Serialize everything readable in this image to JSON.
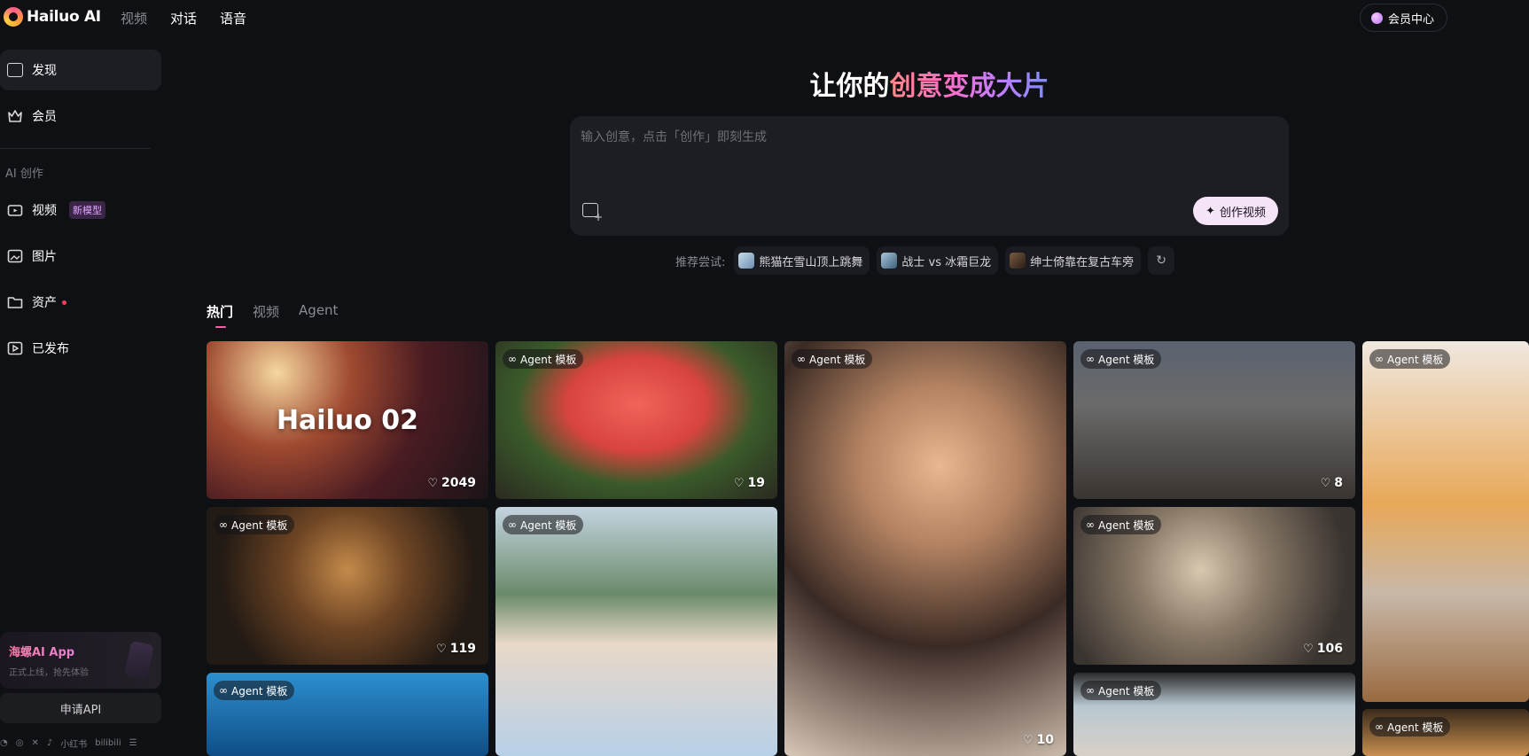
{
  "header": {
    "logo_text": "Hailuo AI",
    "nav": [
      {
        "label": "视频",
        "state": "muted"
      },
      {
        "label": "对话",
        "state": "normal"
      },
      {
        "label": "语音",
        "state": "normal"
      }
    ],
    "vip_button": "会员中心"
  },
  "sidebar": {
    "items": [
      {
        "label": "发现",
        "icon": "discover-icon",
        "active": true
      },
      {
        "label": "会员",
        "icon": "crown-icon",
        "active": false
      }
    ],
    "section_title": "AI 创作",
    "create_items": [
      {
        "label": "视频",
        "icon": "video-icon",
        "badge": "新模型"
      },
      {
        "label": "图片",
        "icon": "image-icon"
      },
      {
        "label": "资产",
        "icon": "folder-icon",
        "dot": true
      },
      {
        "label": "已发布",
        "icon": "published-icon"
      }
    ],
    "app_promo": {
      "title": "海螺AI App",
      "subtitle": "正式上线，抢先体验"
    },
    "api_button": "申请API",
    "social": [
      "wechat-icon",
      "weibo-icon",
      "x-icon",
      "tiktok-icon",
      "小红书",
      "bilibili",
      "more-icon"
    ]
  },
  "hero": {
    "title_plain": "让你的",
    "title_gradient": "创意变成大片",
    "placeholder": "输入创意，点击「创作」即刻生成",
    "create_button": "创作视频"
  },
  "suggestions": {
    "label": "推荐尝试:",
    "chips": [
      {
        "label": "熊猫在雪山顶上跳舞",
        "color": "#7fa6c8"
      },
      {
        "label": "战士 vs 冰霜巨龙",
        "color": "#5e89a8"
      },
      {
        "label": "绅士倚靠在复古车旁",
        "color": "#5b4636"
      }
    ]
  },
  "tabs": [
    {
      "label": "热门",
      "active": true
    },
    {
      "label": "视频",
      "active": false
    },
    {
      "label": "Agent",
      "active": false
    }
  ],
  "cards": [
    {
      "tag": "",
      "big_text": "Hailuo 02",
      "likes": "2049"
    },
    {
      "tag": "Agent 模板",
      "likes": "19"
    },
    {
      "tag": "Agent 模板",
      "likes": "10"
    },
    {
      "tag": "Agent 模板",
      "likes": "8"
    },
    {
      "tag": "Agent 模板",
      "likes": ""
    },
    {
      "tag": "Agent 模板",
      "likes": "119"
    },
    {
      "tag": "Agent 模板",
      "likes": ""
    },
    {
      "tag": "Agent 模板",
      "likes": "106"
    },
    {
      "tag": "Agent 模板",
      "likes": ""
    },
    {
      "tag": "Agent 模板",
      "likes": ""
    },
    {
      "tag": "Agent 模板",
      "likes": ""
    }
  ]
}
